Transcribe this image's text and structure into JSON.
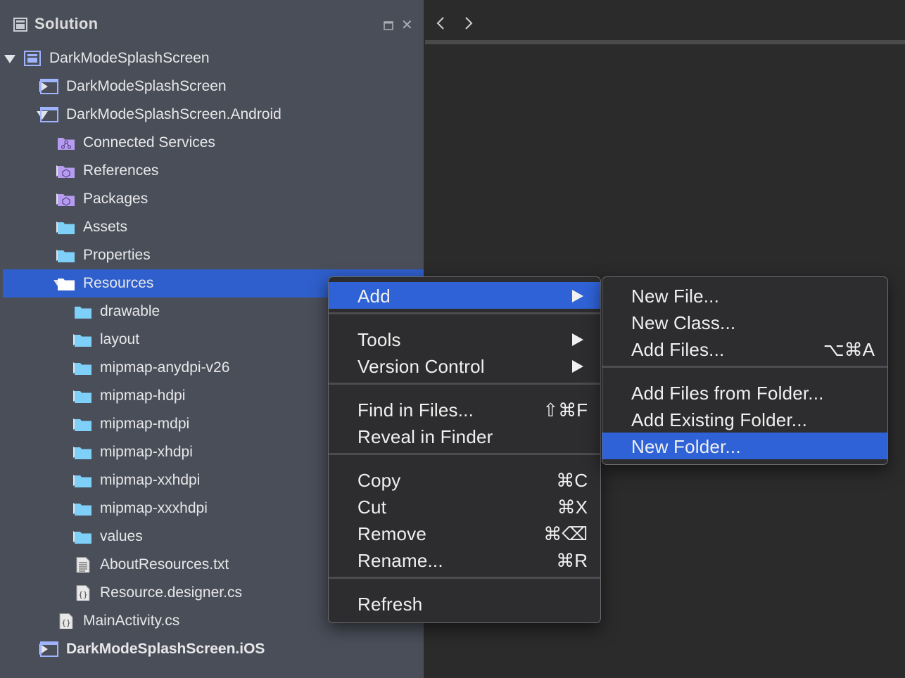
{
  "pad": {
    "title": "Solution"
  },
  "tree": [
    {
      "label": "DarkModeSplashScreen",
      "depth": 0,
      "arrow": "down",
      "icon": "solution-icon"
    },
    {
      "label": "DarkModeSplashScreen",
      "depth": 1,
      "arrow": "right",
      "icon": "project-icon"
    },
    {
      "label": "DarkModeSplashScreen.Android",
      "depth": 1,
      "arrow": "down",
      "icon": "project-icon"
    },
    {
      "label": "Connected Services",
      "depth": 2,
      "arrow": "none",
      "icon": "connected-services-icon"
    },
    {
      "label": "References",
      "depth": 2,
      "arrow": "right",
      "icon": "references-folder-icon"
    },
    {
      "label": "Packages",
      "depth": 2,
      "arrow": "right",
      "icon": "packages-folder-icon"
    },
    {
      "label": "Assets",
      "depth": 2,
      "arrow": "right",
      "icon": "folder-icon"
    },
    {
      "label": "Properties",
      "depth": 2,
      "arrow": "right",
      "icon": "folder-icon"
    },
    {
      "label": "Resources",
      "depth": 2,
      "arrow": "down",
      "icon": "folder-open-icon",
      "selected": true
    },
    {
      "label": "drawable",
      "depth": 3,
      "arrow": "none",
      "icon": "folder-icon"
    },
    {
      "label": "layout",
      "depth": 3,
      "arrow": "right",
      "icon": "folder-icon"
    },
    {
      "label": "mipmap-anydpi-v26",
      "depth": 3,
      "arrow": "right",
      "icon": "folder-icon"
    },
    {
      "label": "mipmap-hdpi",
      "depth": 3,
      "arrow": "right",
      "icon": "folder-icon"
    },
    {
      "label": "mipmap-mdpi",
      "depth": 3,
      "arrow": "right",
      "icon": "folder-icon"
    },
    {
      "label": "mipmap-xhdpi",
      "depth": 3,
      "arrow": "right",
      "icon": "folder-icon"
    },
    {
      "label": "mipmap-xxhdpi",
      "depth": 3,
      "arrow": "right",
      "icon": "folder-icon"
    },
    {
      "label": "mipmap-xxxhdpi",
      "depth": 3,
      "arrow": "right",
      "icon": "folder-icon"
    },
    {
      "label": "values",
      "depth": 3,
      "arrow": "right",
      "icon": "folder-icon"
    },
    {
      "label": "AboutResources.txt",
      "depth": 3,
      "arrow": "none",
      "icon": "text-file-icon"
    },
    {
      "label": "Resource.designer.cs",
      "depth": 3,
      "arrow": "none",
      "icon": "csharp-file-icon"
    },
    {
      "label": "MainActivity.cs",
      "depth": 2,
      "arrow": "none",
      "icon": "csharp-file-icon"
    },
    {
      "label": "DarkModeSplashScreen.iOS",
      "depth": 1,
      "arrow": "right",
      "icon": "project-icon",
      "bold": true
    }
  ],
  "context_menu": {
    "groups": [
      [
        {
          "label": "Add",
          "shortcut": "",
          "submenu": true,
          "highlighted": true
        }
      ],
      [
        {
          "label": "Tools",
          "shortcut": "",
          "submenu": true
        },
        {
          "label": "Version Control",
          "shortcut": "",
          "submenu": true
        }
      ],
      [
        {
          "label": "Find in Files...",
          "shortcut": "⇧⌘F",
          "submenu": false
        },
        {
          "label": "Reveal in Finder",
          "shortcut": "",
          "submenu": false
        }
      ],
      [
        {
          "label": "Copy",
          "shortcut": "⌘C",
          "submenu": false
        },
        {
          "label": "Cut",
          "shortcut": "⌘X",
          "submenu": false
        },
        {
          "label": "Remove",
          "shortcut": "⌘⌫",
          "submenu": false
        },
        {
          "label": "Rename...",
          "shortcut": "⌘R",
          "submenu": false
        }
      ],
      [
        {
          "label": "Refresh",
          "shortcut": "",
          "submenu": false
        }
      ]
    ]
  },
  "add_submenu": {
    "groups": [
      [
        {
          "label": "New File...",
          "shortcut": ""
        },
        {
          "label": "New Class...",
          "shortcut": ""
        },
        {
          "label": "Add Files...",
          "shortcut": "⌥⌘A"
        }
      ],
      [
        {
          "label": "Add Files from Folder...",
          "shortcut": ""
        },
        {
          "label": "Add Existing Folder...",
          "shortcut": ""
        },
        {
          "label": "New Folder...",
          "shortcut": "",
          "highlighted": true
        }
      ]
    ]
  },
  "colors": {
    "pad_background": "#4a4e59",
    "selection": "#2f5fcc",
    "menu_highlight": "#2f62d6",
    "folder": "#7fd0f8",
    "special_folder": "#b69cf0",
    "project_outline": "#9fb3ff"
  }
}
